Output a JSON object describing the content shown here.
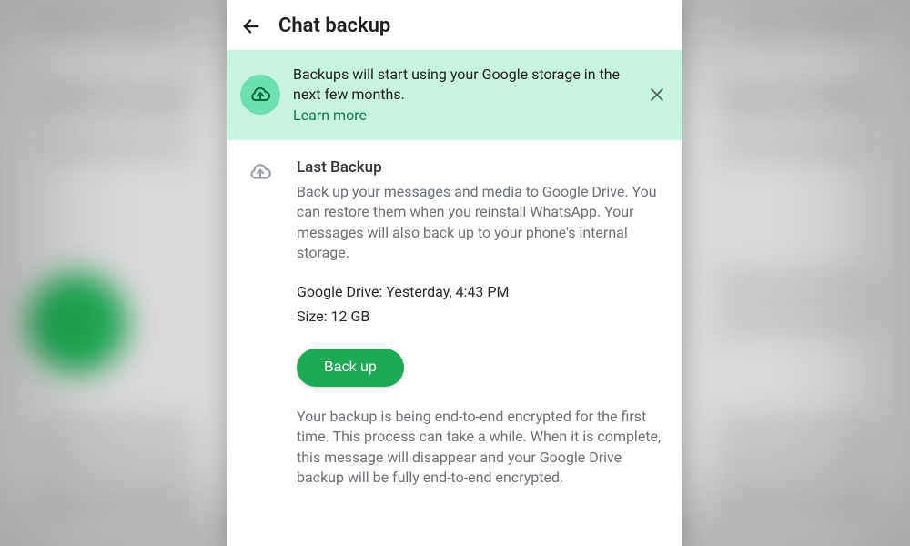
{
  "header": {
    "title": "Chat backup"
  },
  "banner": {
    "message": "Backups will start using your Google storage in the next few months.",
    "link_label": "Learn more"
  },
  "backup": {
    "section_title": "Last Backup",
    "description": "Back up your messages and media to Google Drive. You can restore them when you reinstall WhatsApp. Your messages will also back up to your phone's internal storage.",
    "drive_line": "Google Drive: Yesterday, 4:43 PM",
    "size_line": "Size: 12 GB",
    "button_label": "Back up",
    "encryption_note": "Your backup is being end-to-end encrypted for the first time. This process can take a while. When it is complete, this message will disappear and your Google Drive backup will be fully end-to-end encrypted."
  },
  "colors": {
    "accent": "#1fa855",
    "banner_bg": "#c7f4e0"
  }
}
